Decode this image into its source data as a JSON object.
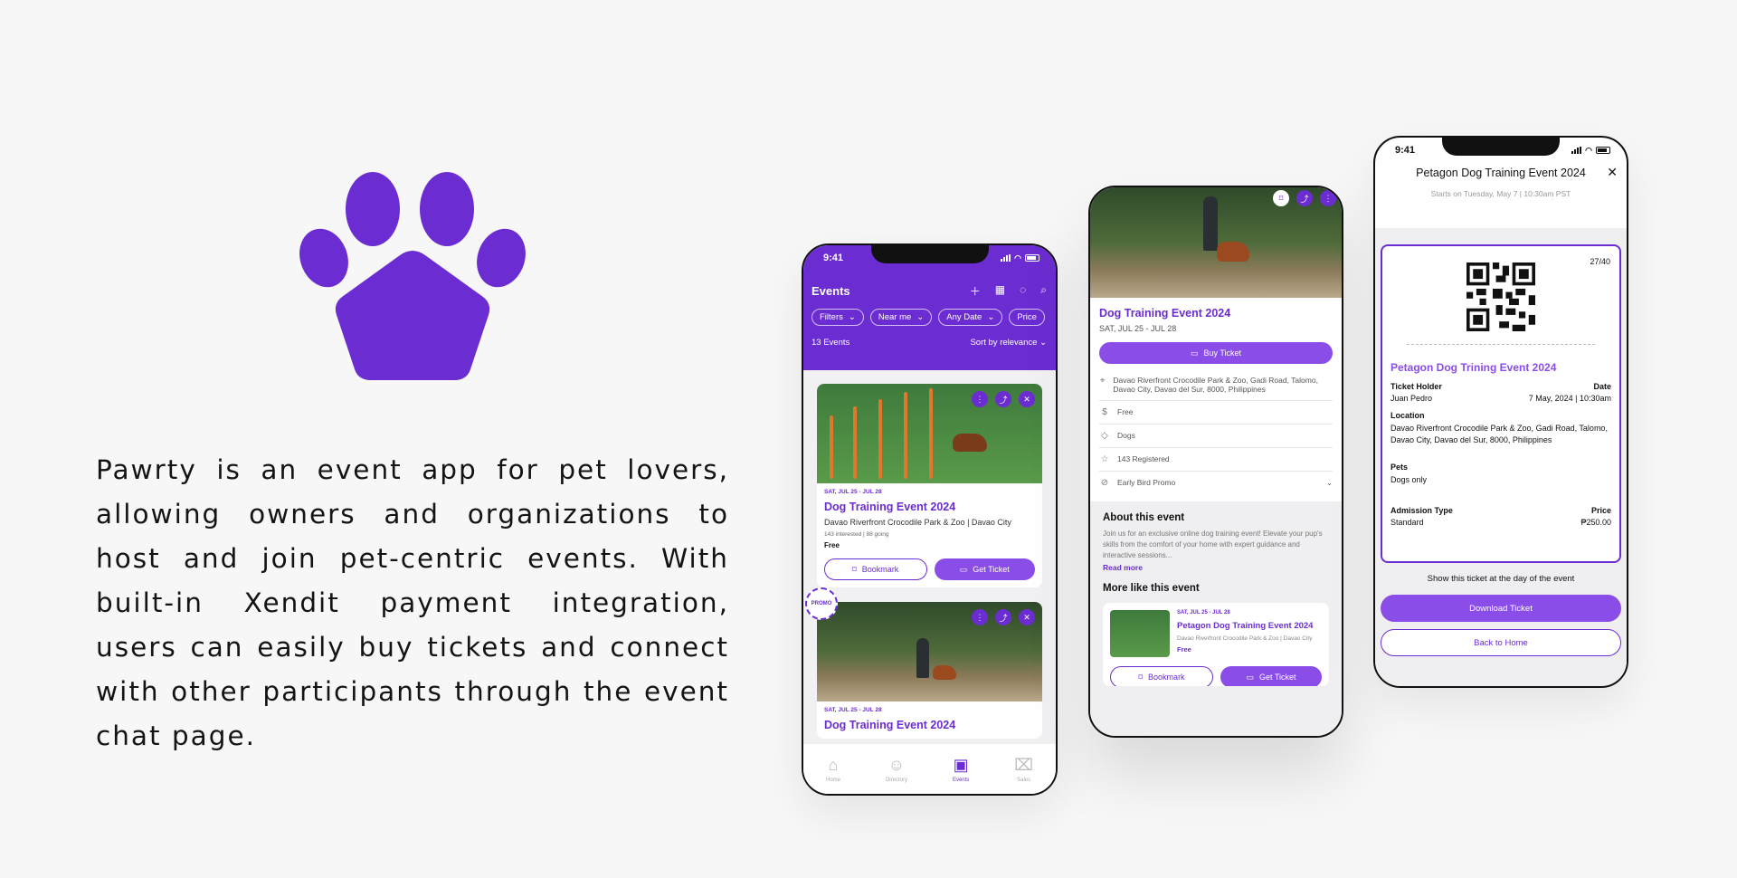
{
  "brand": {
    "tagline": "Pawrty is an event app for pet lovers, allowing owners and organizations to host and join pet-centric events. With built-in Xendit payment integration, users can easily buy tickets and connect with other participants through the event chat page.",
    "color": "#6b2dd1"
  },
  "status_time": "9:41",
  "events_screen": {
    "title": "Events",
    "header_icons": [
      "plus-icon",
      "calendar-icon",
      "chat-icon",
      "search-icon"
    ],
    "filters": [
      "Filters",
      "Near me",
      "Any Date",
      "Price"
    ],
    "count": "13 Events",
    "sort": "Sort by relevance",
    "promo": "PROMO",
    "cards": [
      {
        "date": "SAT, JUL 25 - JUL 28",
        "title": "Dog Training Event 2024",
        "location": "Davao Riverfront Crocodile Park & Zoo | Davao City",
        "interest": "143 interested | 88 going",
        "price": "Free",
        "bookmark": "Bookmark",
        "get_ticket": "Get Ticket"
      },
      {
        "date": "SAT, JUL 25 - JUL 28",
        "title": "Dog Training Event 2024"
      }
    ],
    "tabs": [
      {
        "label": "Home",
        "icon": "home-icon"
      },
      {
        "label": "Directory",
        "icon": "directory-icon"
      },
      {
        "label": "Events",
        "icon": "events-icon"
      },
      {
        "label": "Sales",
        "icon": "sales-icon"
      }
    ]
  },
  "detail_screen": {
    "title": "Dog Training Event 2024",
    "date": "SAT, JUL 25 - JUL 28",
    "buy": "Buy Ticket",
    "location": "Davao Riverfront Crocodile Park & Zoo, Gadi Road, Talomo, Davao City, Davao del Sur, 8000, Philippines",
    "price": "Free",
    "pets": "Dogs",
    "registered": "143 Registered",
    "promo": "Early Bird Promo",
    "about_heading": "About this event",
    "about_text": "Join us for an exclusive online dog training event! Elevate your pup's skills from the comfort of your home with expert guidance and interactive sessions...",
    "read_more": "Read more",
    "more_heading": "More like this event",
    "more_card": {
      "date": "SAT, JUL 25 - JUL 28",
      "title": "Petagon Dog Training Event 2024",
      "location": "Davao Riverfront Crocodile Park & Zoo | Davao City",
      "price": "Free",
      "bookmark": "Bookmark",
      "get_ticket": "Get Ticket"
    }
  },
  "ticket_screen": {
    "title": "Petagon Dog Training Event 2024",
    "subtitle": "Starts on Tuesday, May 7 | 10:30am PST",
    "count": "27/40",
    "event_title": "Petagon Dog Trining Event 2024",
    "holder_label": "Ticket Holder",
    "holder": "Juan Pedro",
    "date_label": "Date",
    "date": "7 May, 2024 | 10:30am",
    "location_label": "Location",
    "location": "Davao Riverfront Crocodile Park & Zoo, Gadi Road, Talomo, Davao City, Davao del Sur, 8000, Philippines",
    "pets_label": "Pets",
    "pets": "Dogs only",
    "admission_label": "Admission Type",
    "admission": "Standard",
    "price_label": "Price",
    "price": "₱250.00",
    "note": "Show this ticket at the day of the event",
    "download": "Download Ticket",
    "back": "Back to Home"
  }
}
